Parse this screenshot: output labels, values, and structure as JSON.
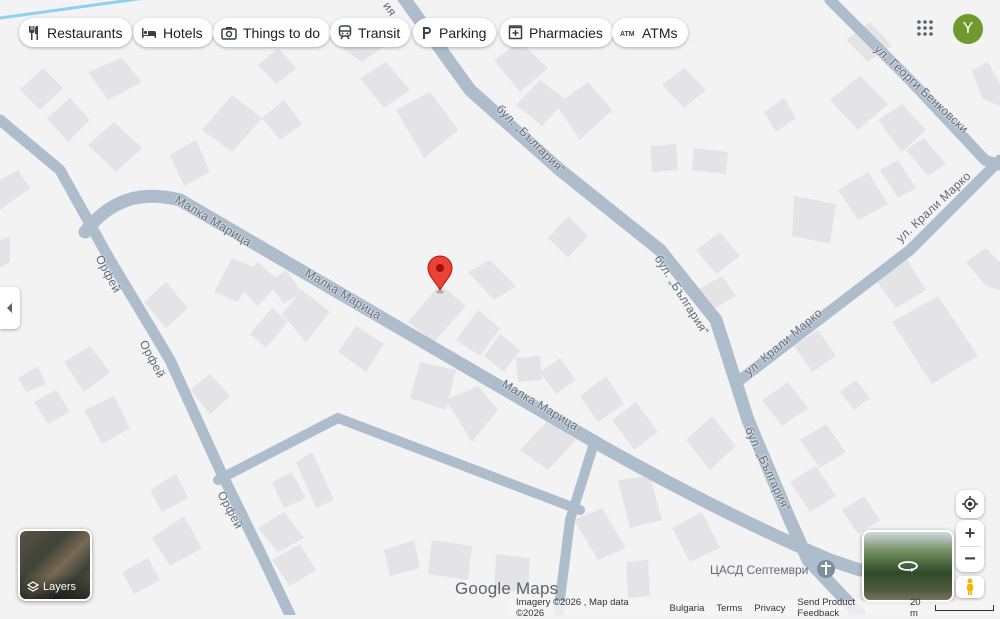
{
  "categories": [
    {
      "id": "restaurants",
      "label": "Restaurants",
      "icon": "fork-knife-icon"
    },
    {
      "id": "hotels",
      "label": "Hotels",
      "icon": "bed-icon"
    },
    {
      "id": "things",
      "label": "Things to do",
      "icon": "camera-icon"
    },
    {
      "id": "transit",
      "label": "Transit",
      "icon": "train-icon"
    },
    {
      "id": "parking",
      "label": "Parking",
      "icon": "parking-icon"
    },
    {
      "id": "pharmacies",
      "label": "Pharmacies",
      "icon": "pharmacy-icon"
    },
    {
      "id": "atms",
      "label": "ATMs",
      "icon": "atm-icon"
    }
  ],
  "account": {
    "initial": "Y",
    "color": "#6f9a2e"
  },
  "streets": {
    "malka_1": "Малка Марица",
    "malka_2": "Малка Марица",
    "malka_3": "Малка Марица",
    "orfey_1": "Орфей",
    "orfey_2": "Орфей",
    "orfey_3": "Орфей",
    "bulgaria_1": "бул. „България“",
    "bulgaria_2": "бул. „България“",
    "bulgaria_3": "бул. „България“",
    "georgi": "ул. Георги Бенковски",
    "krali_1": "ул. Крали Марко",
    "krali_2": "ул. Крали Марко"
  },
  "poi": {
    "label": "ЦАСД Септември",
    "icon": "cross-icon"
  },
  "layers": {
    "label": "Layers"
  },
  "logo": {
    "text": "Google Maps"
  },
  "footer": {
    "imagery": "Imagery ©2026 , Map data ©2026",
    "country": "Bulgaria",
    "terms": "Terms",
    "privacy": "Privacy",
    "feedback": "Send Product Feedback",
    "scale": "20 m"
  },
  "colors": {
    "land": "#f3f3f4",
    "road": "#aebdcc",
    "building": "#e4e4e6",
    "pin": "#ea4335"
  }
}
